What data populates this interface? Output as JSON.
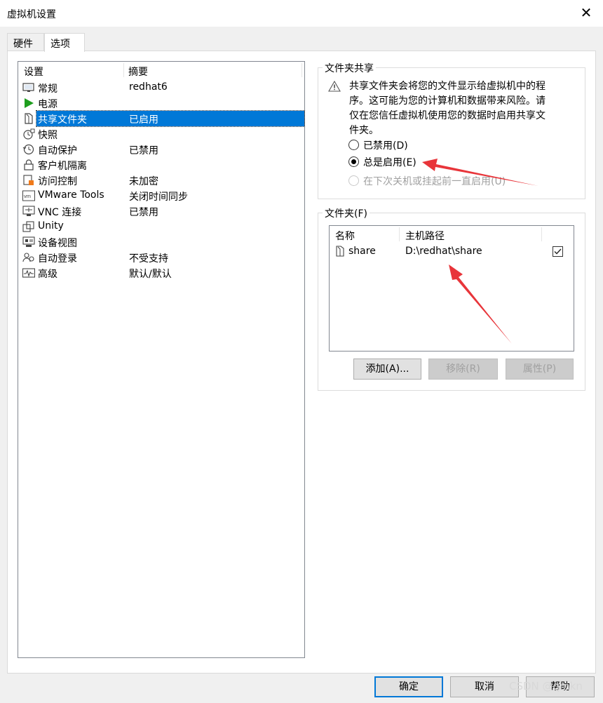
{
  "window": {
    "title": "虚拟机设置",
    "close_glyph": "✕"
  },
  "tabs": [
    {
      "label": "硬件"
    },
    {
      "label": "选项"
    }
  ],
  "settings_list": {
    "header": {
      "col_setting": "设置",
      "col_summary": "摘要"
    },
    "items": [
      {
        "label": "常规",
        "value": "redhat6",
        "icon": "monitor-icon"
      },
      {
        "label": "电源",
        "value": "",
        "icon": "power-play-icon"
      },
      {
        "label": "共享文件夹",
        "value": "已启用",
        "icon": "shared-folder-icon",
        "selected": true
      },
      {
        "label": "快照",
        "value": "",
        "icon": "snapshot-icon"
      },
      {
        "label": "自动保护",
        "value": "已禁用",
        "icon": "autoprotect-clock-icon"
      },
      {
        "label": "客户机隔离",
        "value": "",
        "icon": "lock-icon"
      },
      {
        "label": "访问控制",
        "value": "未加密",
        "icon": "access-control-icon"
      },
      {
        "label": "VMware Tools",
        "value": "关闭时间同步",
        "icon": "vmware-tools-icon"
      },
      {
        "label": "VNC 连接",
        "value": "已禁用",
        "icon": "vnc-icon"
      },
      {
        "label": "Unity",
        "value": "",
        "icon": "unity-icon"
      },
      {
        "label": "设备视图",
        "value": "",
        "icon": "device-view-icon"
      },
      {
        "label": "自动登录",
        "value": "不受支持",
        "icon": "autologon-users-icon"
      },
      {
        "label": "高级",
        "value": "默认/默认",
        "icon": "advanced-pulse-icon"
      }
    ]
  },
  "shared_folders_group": {
    "title": "文件夹共享",
    "warning": "共享文件夹会将您的文件显示给虚拟机中的程序。这可能为您的计算机和数据带来风险。请仅在您信任虚拟机使用您的数据时启用共享文件夹。",
    "options": [
      {
        "label": "已禁用(D)",
        "checked": false,
        "disabled": false
      },
      {
        "label": "总是启用(E)",
        "checked": true,
        "disabled": false
      },
      {
        "label": "在下次关机或挂起前一直启用(U)",
        "checked": false,
        "disabled": true
      }
    ]
  },
  "folders_group": {
    "title": "文件夹(F)",
    "columns": {
      "name": "名称",
      "path": "主机路径"
    },
    "rows": [
      {
        "name": "share",
        "path": "D:\\redhat\\share",
        "enabled": true
      }
    ],
    "buttons": {
      "add": "添加(A)...",
      "remove": "移除(R)",
      "properties": "属性(P)"
    }
  },
  "footer": {
    "ok": "确定",
    "cancel": "取消",
    "help": "帮助"
  },
  "watermark": "CSDN @qmkn",
  "colors": {
    "selection": "#0078d7",
    "arrow": "#e8353a",
    "power_green": "#1e9e1e"
  }
}
